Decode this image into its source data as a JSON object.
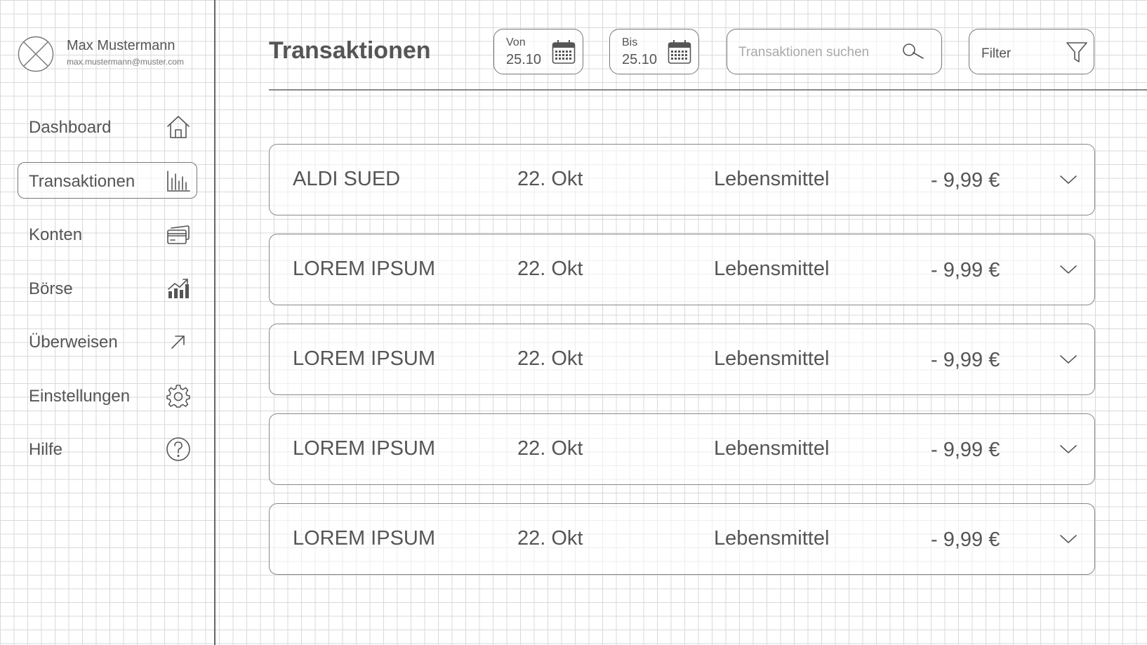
{
  "profile": {
    "name": "Max Mustermann",
    "email": "max.mustermann@muster.com"
  },
  "sidebar": {
    "items": [
      {
        "label": "Dashboard",
        "icon": "home-icon",
        "active": false
      },
      {
        "label": "Transaktionen",
        "icon": "bar-chart-icon",
        "active": true
      },
      {
        "label": "Konten",
        "icon": "credit-card-icon",
        "active": false
      },
      {
        "label": "Börse",
        "icon": "stock-chart-icon",
        "active": false
      },
      {
        "label": "Überweisen",
        "icon": "arrow-up-right-icon",
        "active": false
      },
      {
        "label": "Einstellungen",
        "icon": "gear-icon",
        "active": false
      },
      {
        "label": "Hilfe",
        "icon": "help-icon",
        "active": false
      }
    ]
  },
  "header": {
    "title": "Transaktionen",
    "from": {
      "label": "Von",
      "value": "25.10"
    },
    "to": {
      "label": "Bis",
      "value": "25.10"
    },
    "search": {
      "placeholder": "Transaktionen suchen",
      "value": ""
    },
    "filter": {
      "label": "Filter"
    }
  },
  "transactions": [
    {
      "name": "ALDI SUED",
      "date": "22. Okt",
      "category": "Lebensmittel",
      "amount": "- 9,99 €"
    },
    {
      "name": "LOREM IPSUM",
      "date": "22. Okt",
      "category": "Lebensmittel",
      "amount": "- 9,99 €"
    },
    {
      "name": "LOREM IPSUM",
      "date": "22. Okt",
      "category": "Lebensmittel",
      "amount": "- 9,99 €"
    },
    {
      "name": "LOREM IPSUM",
      "date": "22. Okt",
      "category": "Lebensmittel",
      "amount": "- 9,99 €"
    },
    {
      "name": "LOREM IPSUM",
      "date": "22. Okt",
      "category": "Lebensmittel",
      "amount": "- 9,99 €"
    }
  ]
}
